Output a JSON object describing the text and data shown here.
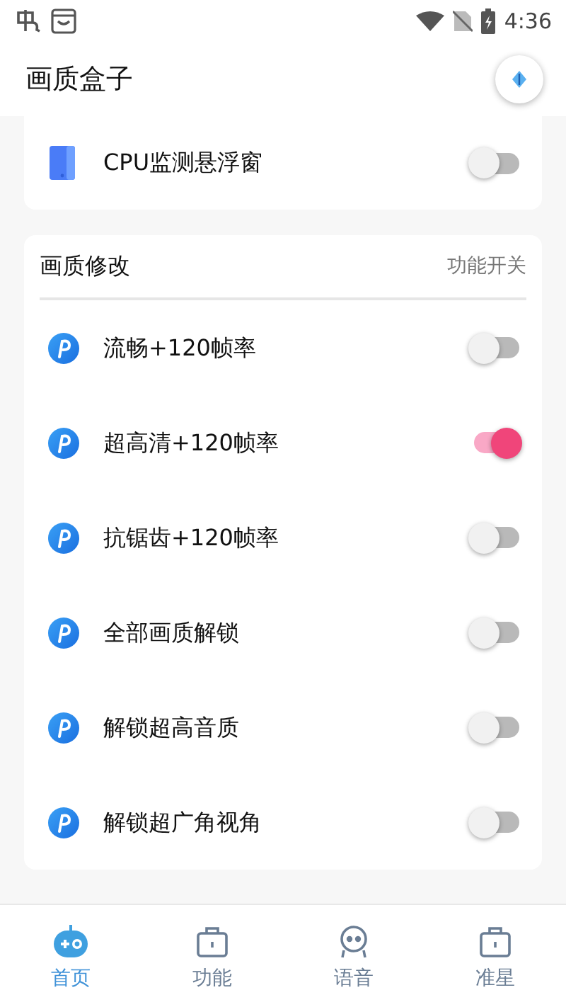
{
  "status_bar": {
    "time": "4:36"
  },
  "header": {
    "title": "画质盒子"
  },
  "top_card": {
    "items": [
      {
        "label": "CPU监测悬浮窗",
        "on": false
      }
    ]
  },
  "section": {
    "title": "画质修改",
    "action": "功能开关",
    "items": [
      {
        "label": "流畅+120帧率",
        "on": false
      },
      {
        "label": "超高清+120帧率",
        "on": true
      },
      {
        "label": "抗锯齿+120帧率",
        "on": false
      },
      {
        "label": "全部画质解锁",
        "on": false
      },
      {
        "label": "解锁超高音质",
        "on": false
      },
      {
        "label": "解锁超广角视角",
        "on": false
      }
    ]
  },
  "bottom_nav": [
    {
      "label": "首页",
      "kind": "gamepad",
      "selected": true
    },
    {
      "label": "功能",
      "kind": "case",
      "selected": false
    },
    {
      "label": "语音",
      "kind": "face",
      "selected": false
    },
    {
      "label": "准星",
      "kind": "case",
      "selected": false
    }
  ]
}
